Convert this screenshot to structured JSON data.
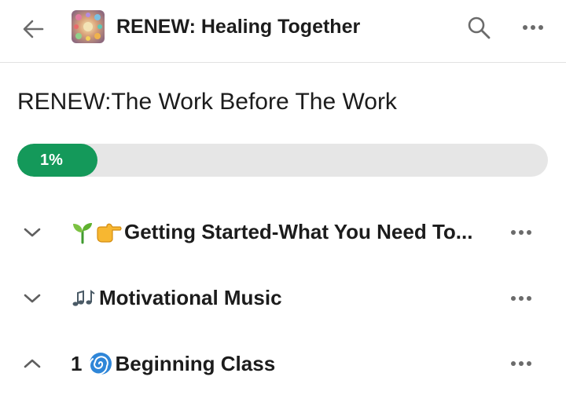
{
  "header": {
    "title": "RENEW: Healing Together",
    "back_icon": "arrow-left-icon",
    "search_icon": "search-icon",
    "more_icon": "more-horizontal-icon"
  },
  "course": {
    "title": "RENEW:The Work Before The Work",
    "progress_label": "1%",
    "progress_value": 0.01,
    "progress_color": "#14995a"
  },
  "sections": [
    {
      "label": "Getting Started-What You Need To...",
      "prefix": "",
      "emoji": "seedling-pointing-icons",
      "expanded": false
    },
    {
      "label": "Motivational Music",
      "prefix": "",
      "emoji": "music-notes-icon",
      "expanded": false
    },
    {
      "label": "Beginning Class",
      "prefix": "1",
      "emoji": "cyclone-icon",
      "expanded": true
    }
  ]
}
